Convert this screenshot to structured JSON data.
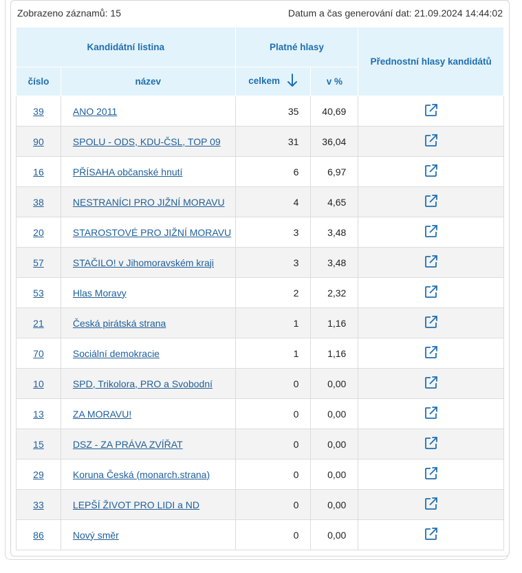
{
  "summary": {
    "records_label": "Zobrazeno záznamů: 15",
    "generated_label": "Datum a čas generování dat: 21.09.2024 14:44:02"
  },
  "headers": {
    "list": "Kandidátní listina",
    "valid_votes": "Platné hlasy",
    "preferential": "Přednostní hlasy kandidátů",
    "number": "číslo",
    "name": "název",
    "total": "celkem",
    "percent": "v %"
  },
  "colors": {
    "accent": "#1f6fb2",
    "header_bg": "#e3f3fb",
    "link": "#1f5f9a"
  },
  "icons": {
    "sort": "arrow-down-icon",
    "link": "external-link-icon"
  },
  "rows": [
    {
      "number": "39",
      "name": "ANO 2011",
      "total": "35",
      "percent": "40,69"
    },
    {
      "number": "90",
      "name": "SPOLU - ODS, KDU-ČSL, TOP 09",
      "total": "31",
      "percent": "36,04"
    },
    {
      "number": "16",
      "name": "PŘÍSAHA občanské hnutí",
      "total": "6",
      "percent": "6,97"
    },
    {
      "number": "38",
      "name": "NESTRANÍCI PRO JIŽNÍ MORAVU",
      "total": "4",
      "percent": "4,65"
    },
    {
      "number": "20",
      "name": "STAROSTOVÉ PRO JIŽNÍ MORAVU",
      "total": "3",
      "percent": "3,48"
    },
    {
      "number": "57",
      "name": "STAČILO! v Jihomoravském kraji",
      "total": "3",
      "percent": "3,48"
    },
    {
      "number": "53",
      "name": "Hlas Moravy",
      "total": "2",
      "percent": "2,32"
    },
    {
      "number": "21",
      "name": "Česká pirátská strana",
      "total": "1",
      "percent": "1,16"
    },
    {
      "number": "70",
      "name": "Sociální demokracie",
      "total": "1",
      "percent": "1,16"
    },
    {
      "number": "10",
      "name": "SPD, Trikolora, PRO a Svobodní",
      "total": "0",
      "percent": "0,00"
    },
    {
      "number": "13",
      "name": "ZA MORAVU!",
      "total": "0",
      "percent": "0,00"
    },
    {
      "number": "15",
      "name": "DSZ - ZA PRÁVA ZVÍŘAT",
      "total": "0",
      "percent": "0,00"
    },
    {
      "number": "29",
      "name": "Koruna Česká (monarch.strana)",
      "total": "0",
      "percent": "0,00"
    },
    {
      "number": "33",
      "name": "LEPŠÍ ŽIVOT PRO LIDI a ND",
      "total": "0",
      "percent": "0,00"
    },
    {
      "number": "86",
      "name": "Nový směr",
      "total": "0",
      "percent": "0,00"
    }
  ]
}
